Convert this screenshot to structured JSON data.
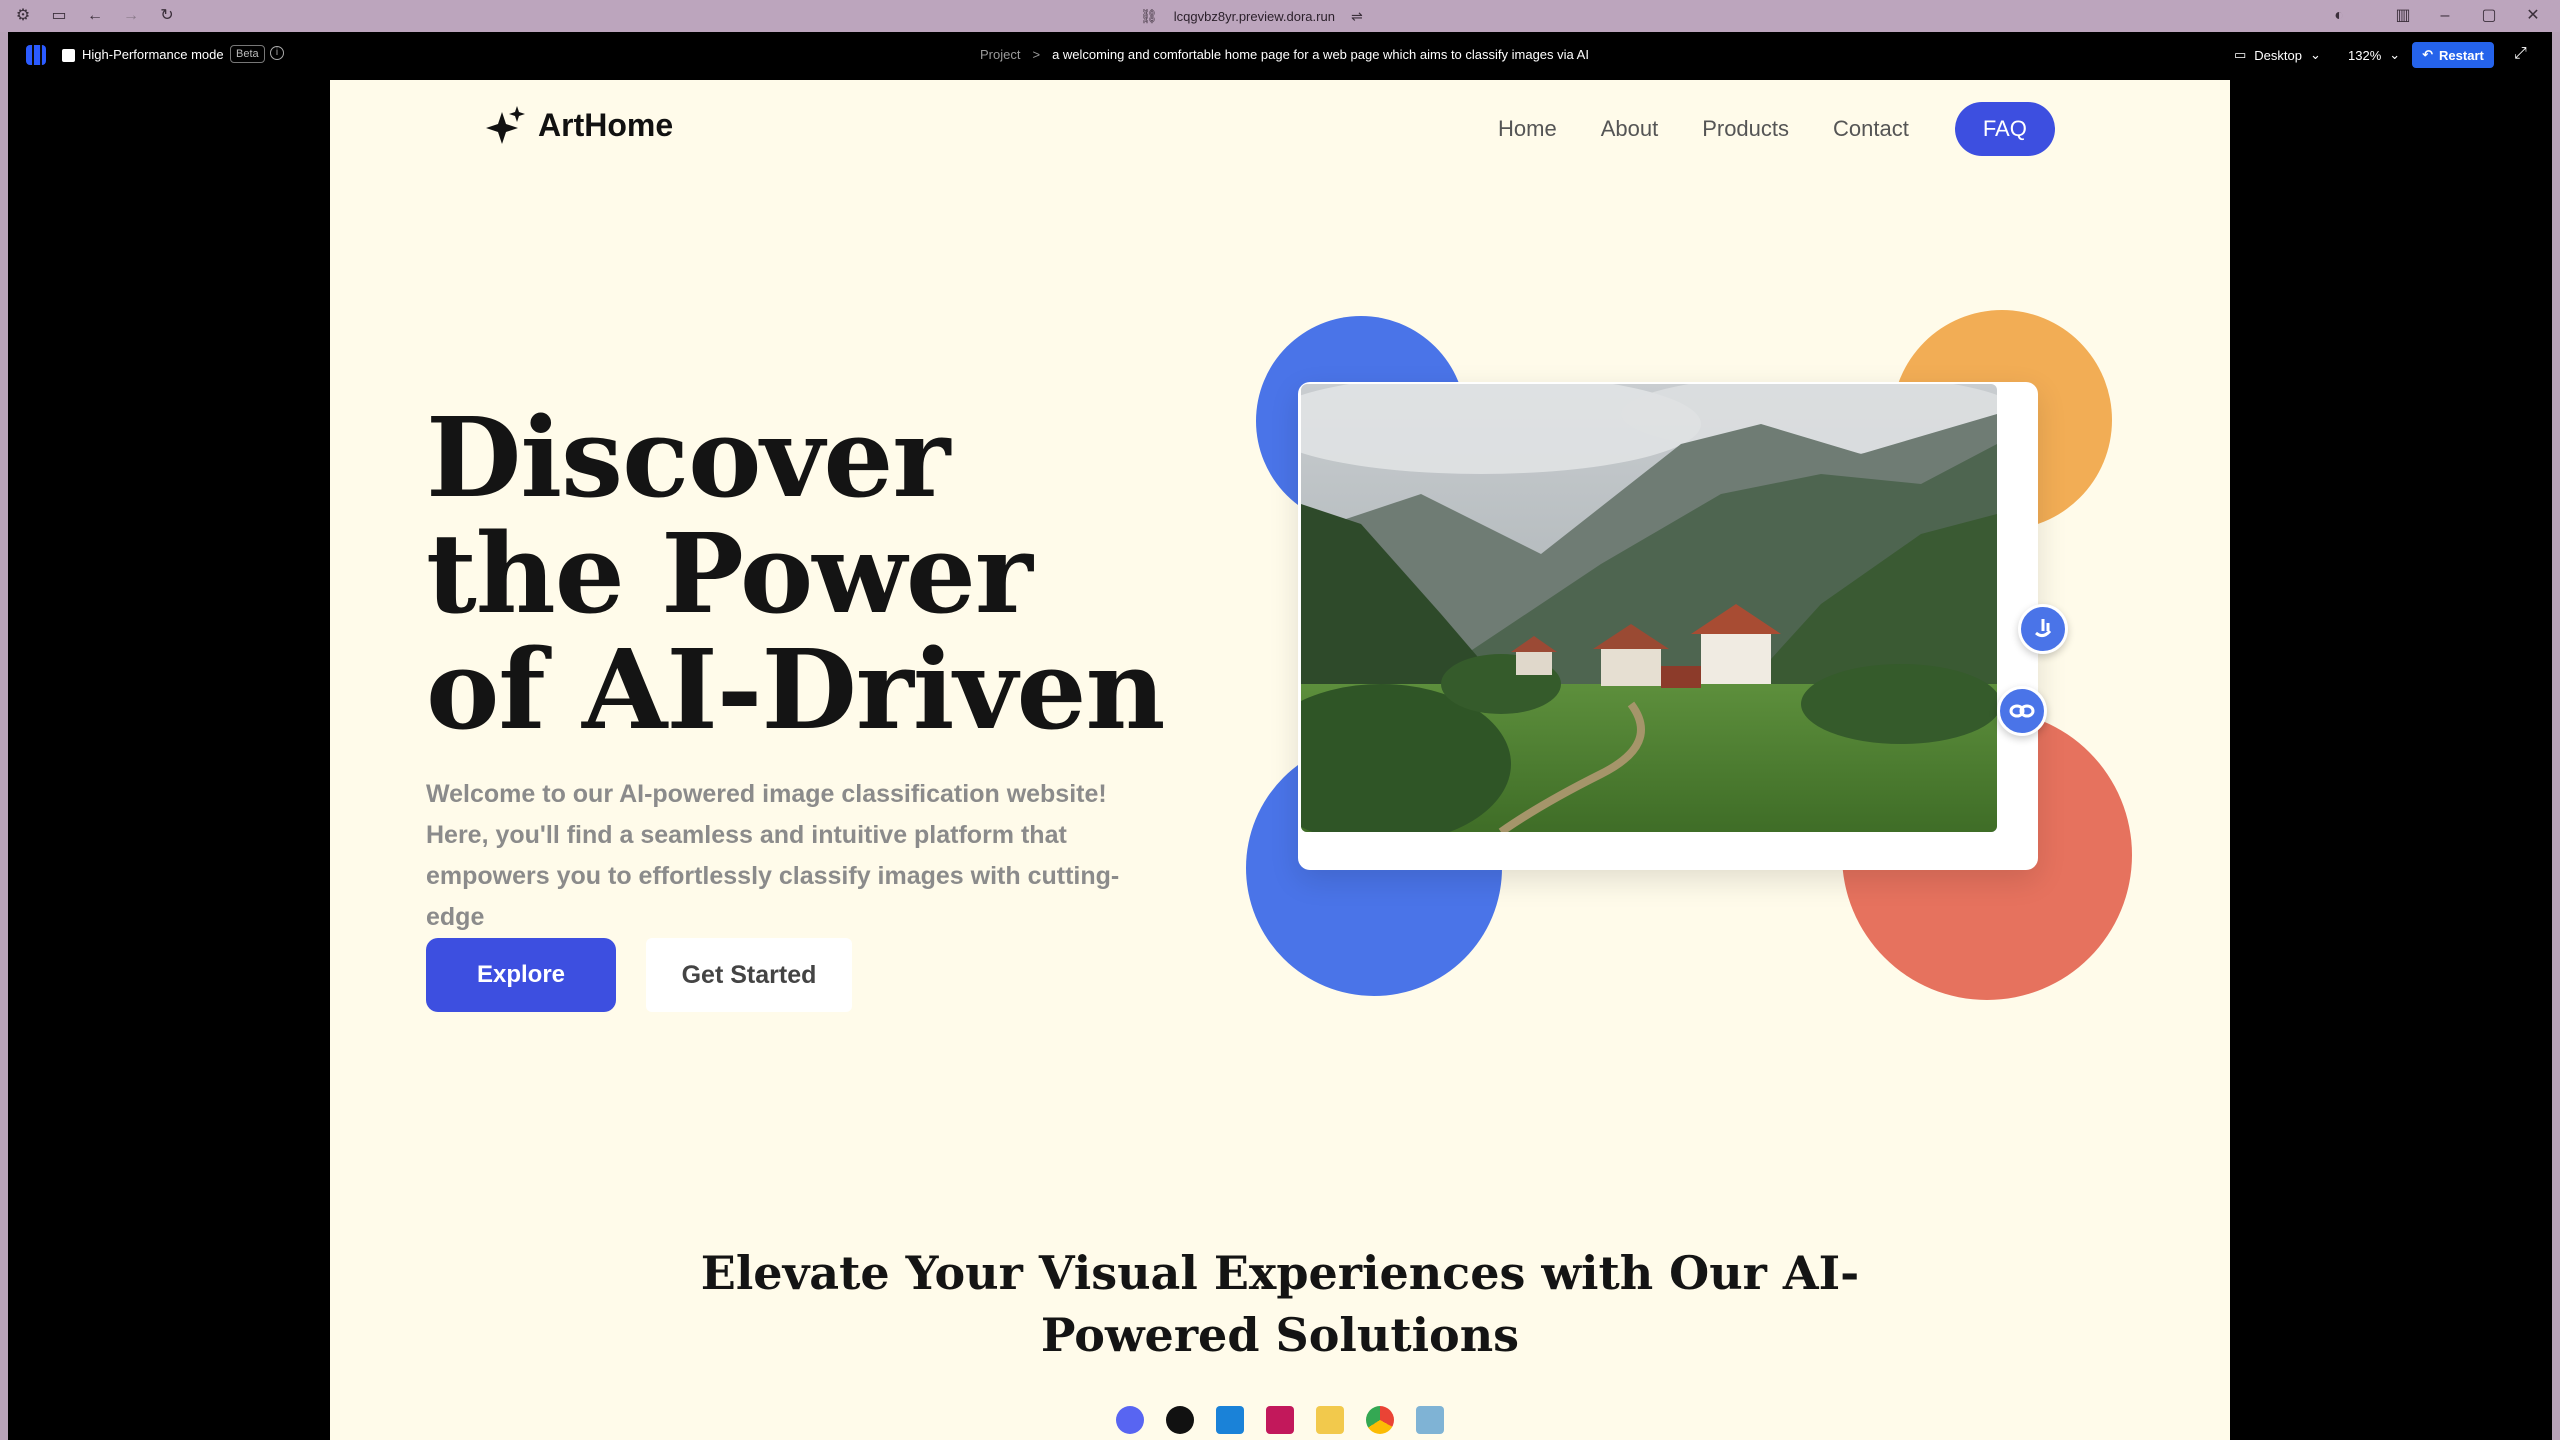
{
  "browser": {
    "url": "lcqgvbz8yr.preview.dora.run"
  },
  "toolbar": {
    "mode_label": "High-Performance mode",
    "beta_badge": "Beta",
    "breadcrumb_root": "Project",
    "breadcrumb_separator": ">",
    "breadcrumb_current": "a welcoming and comfortable home page for a web page which aims to classify images via AI",
    "device": "Desktop",
    "zoom": "132%",
    "restart_label": "Restart"
  },
  "site": {
    "brand_name": "ArtHome",
    "nav": {
      "home": "Home",
      "about": "About",
      "products": "Products",
      "contact": "Contact",
      "faq": "FAQ"
    },
    "hero": {
      "title": "Discover the Power of AI-Driven",
      "description": "Welcome to our AI-powered image classification website! Here, you'll find a seamless and intuitive platform that empowers you to effortlessly classify images with cutting-edge",
      "explore_label": "Explore",
      "get_started_label": "Get Started"
    },
    "section_title": "Elevate Your Visual Experiences with Our AI-Powered Solutions"
  },
  "colors": {
    "accent": "#3d4fe0",
    "page_bg": "#fffbea",
    "blob_blue": "#4a74e8",
    "blob_orange": "#f2ad55",
    "blob_coral": "#e6725e",
    "restart_blue": "#2563eb"
  },
  "icons": {
    "brand": "sparkle-icon",
    "float_1": "refresh-hand-icon",
    "float_2": "link-icon",
    "taskbar": [
      "discord-icon",
      "github-icon",
      "vscode-icon",
      "design-app-icon",
      "file-explorer-icon",
      "chrome-icon",
      "editor-icon"
    ]
  }
}
